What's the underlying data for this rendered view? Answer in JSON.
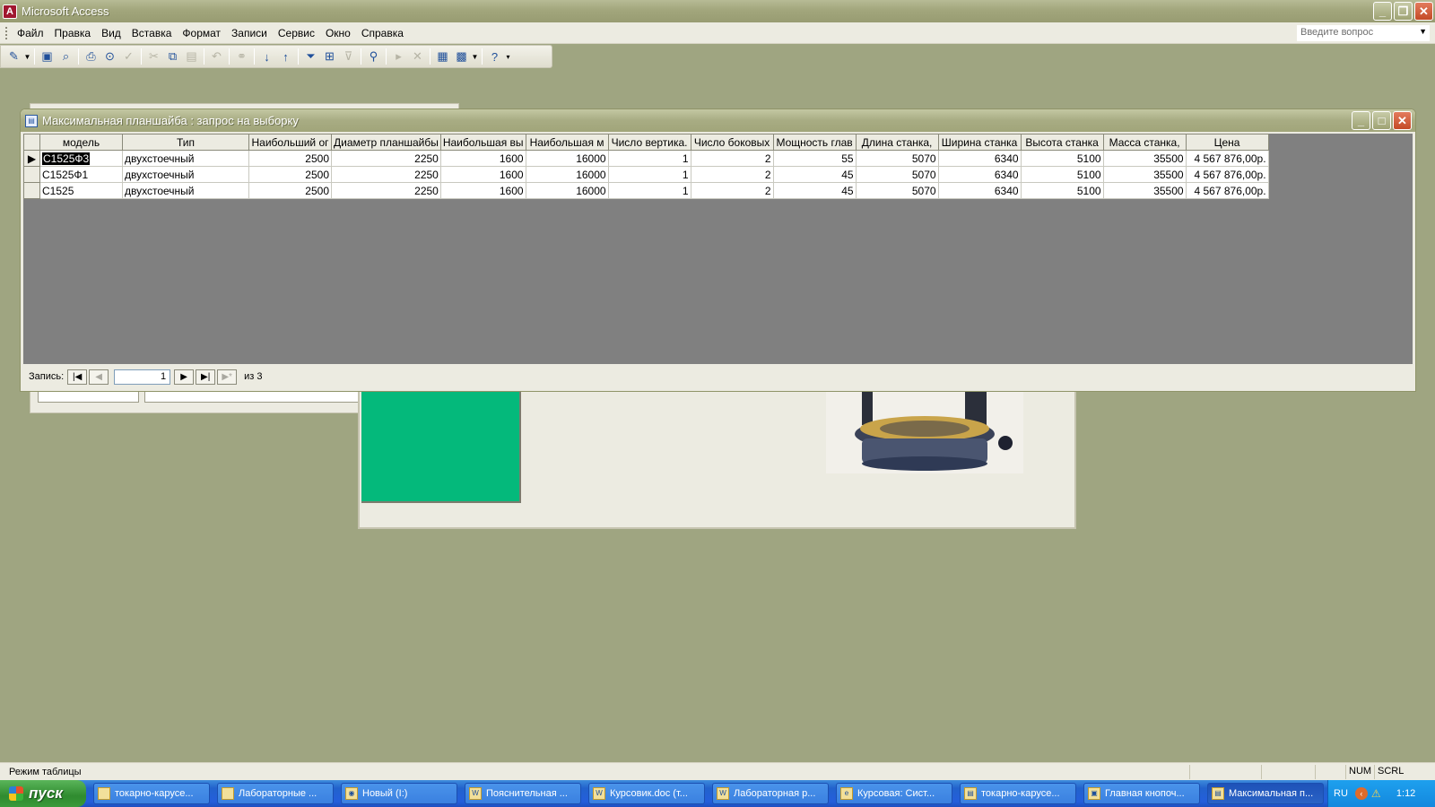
{
  "app": {
    "title": "Microsoft Access",
    "icon_letter": "A"
  },
  "menu": {
    "items": [
      "Файл",
      "Правка",
      "Вид",
      "Вставка",
      "Формат",
      "Записи",
      "Сервис",
      "Окно",
      "Справка"
    ],
    "ask_placeholder": "Введите вопрос"
  },
  "query_window": {
    "title": "Максимальная планшайба : запрос на выборку",
    "columns": [
      "модель",
      "Тип",
      "Наибольший ог",
      "Диаметр планшайбы",
      "Наибольшая вы",
      "Наибольшая м",
      "Число вертика.",
      "Число боковых",
      "Мощность глав",
      "Длина станка,",
      "Ширина станка",
      "Высота станка",
      "Масса станка,",
      "Цена"
    ],
    "rows": [
      [
        "С1525Ф3",
        "двухстоечный",
        "2500",
        "2250",
        "1600",
        "16000",
        "1",
        "2",
        "55",
        "5070",
        "6340",
        "5100",
        "35500",
        "4 567 876,00р."
      ],
      [
        "С1525Ф1",
        "двухстоечный",
        "2500",
        "2250",
        "1600",
        "16000",
        "1",
        "2",
        "45",
        "5070",
        "6340",
        "5100",
        "35500",
        "4 567 876,00р."
      ],
      [
        "С1525",
        "двухстоечный",
        "2500",
        "2250",
        "1600",
        "16000",
        "1",
        "2",
        "45",
        "5070",
        "6340",
        "5100",
        "35500",
        "4 567 876,00р."
      ]
    ],
    "current_row_marker": "▶",
    "nav": {
      "label": "Запись:",
      "current": "1",
      "of_label": "из 3"
    }
  },
  "statusbar": {
    "text": "Режим таблицы",
    "num": "NUM",
    "scrl": "SCRL"
  },
  "taskbar": {
    "start_label": "пуск",
    "tasks": [
      "токарно-карусе...",
      "Лабораторные ...",
      "Новый (I:)",
      "Пояснительная ...",
      "Курсовик.doc (т...",
      "Лабораторная р...",
      "Курсовая: Сист...",
      "токарно-карусе...",
      "Главная кнопоч...",
      "Максимальная п..."
    ],
    "lang": "RU",
    "clock": "1:12"
  },
  "colors": {
    "desktop_bg": "#9fa581",
    "title_bar": "#a2a67c",
    "grid_empty": "#808080",
    "form_green": "#04b97b",
    "taskbar": "#245edb",
    "start_button": "#2f8b2f"
  }
}
